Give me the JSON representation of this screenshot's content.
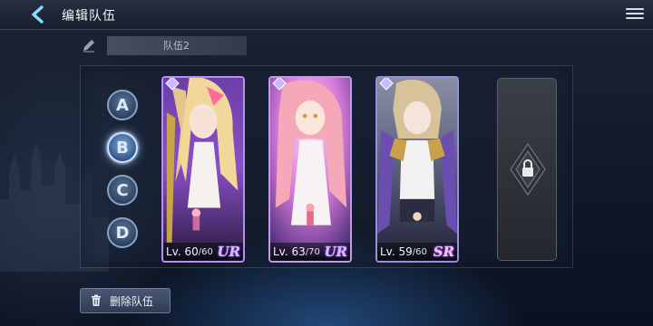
{
  "header": {
    "title": "编辑队伍"
  },
  "team_name": {
    "value": "队伍2"
  },
  "slots": [
    {
      "label": "A",
      "active": false
    },
    {
      "label": "B",
      "active": true
    },
    {
      "label": "C",
      "active": false
    },
    {
      "label": "D",
      "active": false
    }
  ],
  "cards": [
    {
      "level_text": "Lv. 60",
      "max_text": "/60",
      "rarity": "UR"
    },
    {
      "level_text": "Lv. 63",
      "max_text": "/70",
      "rarity": "UR"
    },
    {
      "level_text": "Lv. 59",
      "max_text": "/60",
      "rarity": "SR"
    }
  ],
  "delete_button": {
    "label": "删除队伍"
  },
  "icons": {
    "back": "back-chevron-icon",
    "menu": "hamburger-menu-icon",
    "edit": "pencil-icon",
    "lock": "lock-icon",
    "delete": "trash-icon"
  }
}
